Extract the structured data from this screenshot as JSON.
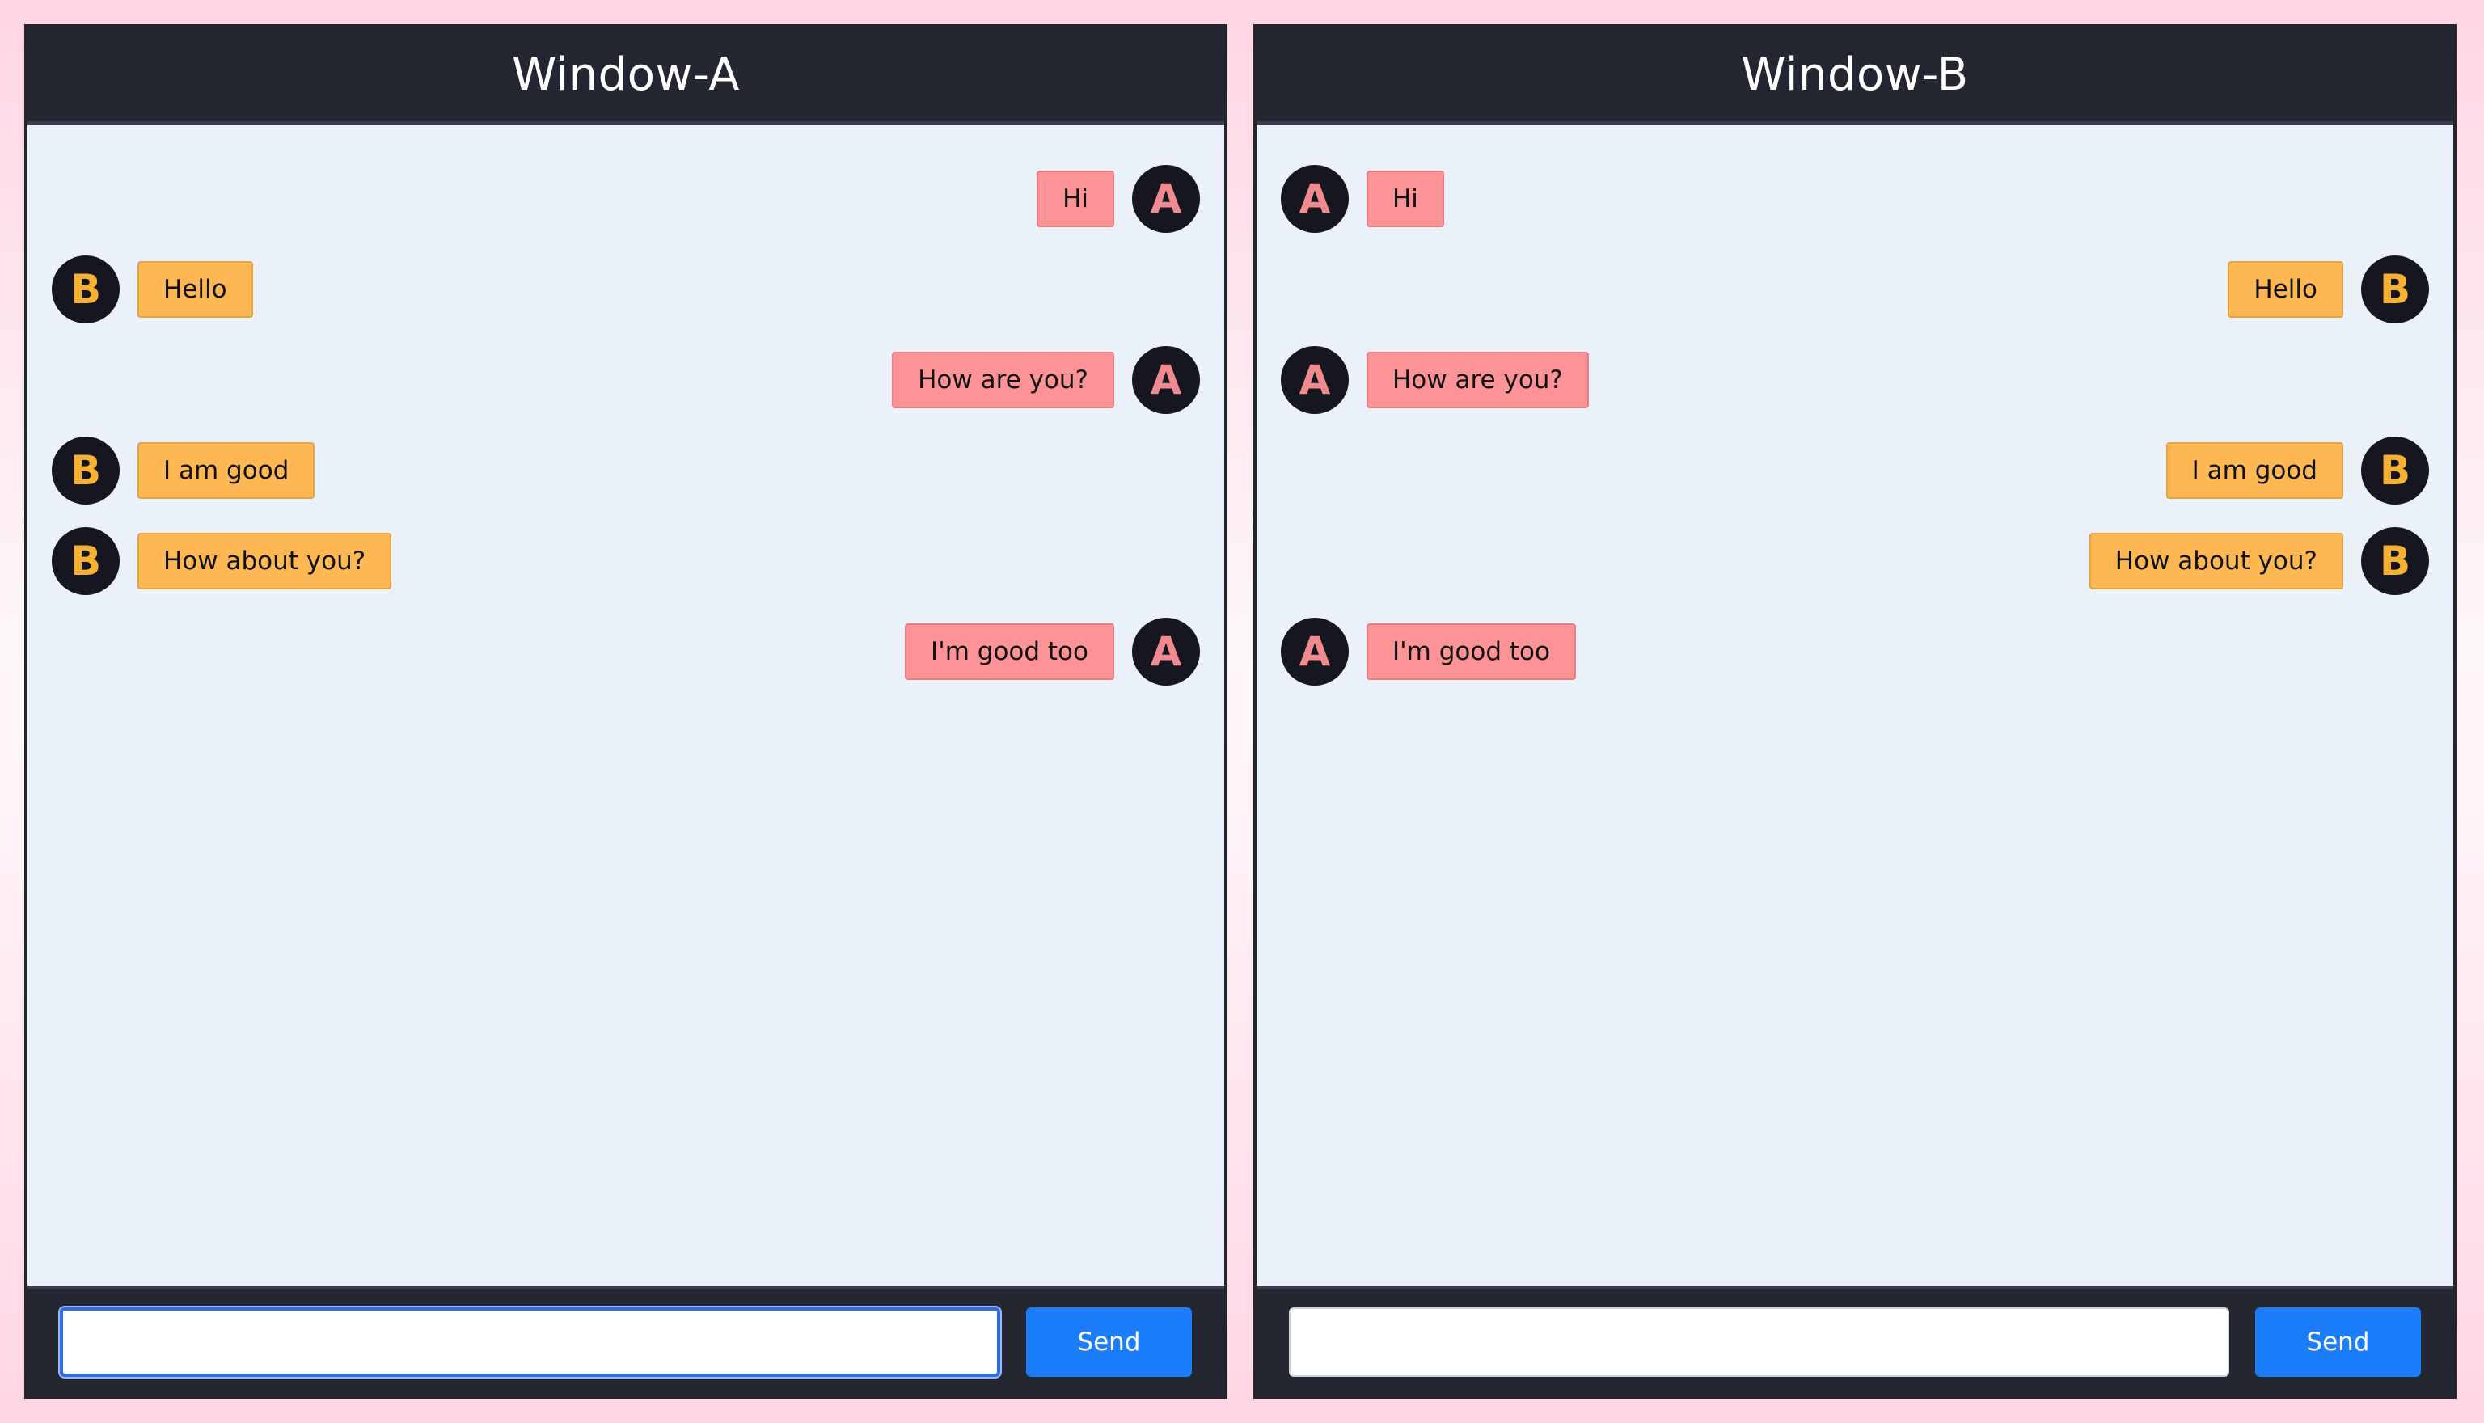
{
  "window_a": {
    "title": "Window-A",
    "send_label": "Send",
    "input_value": "",
    "input_focused": true,
    "messages": [
      {
        "sender": "A",
        "text": "Hi",
        "align": "right"
      },
      {
        "sender": "B",
        "text": "Hello",
        "align": "left"
      },
      {
        "sender": "A",
        "text": "How are you?",
        "align": "right"
      },
      {
        "sender": "B",
        "text": "I am good",
        "align": "left"
      },
      {
        "sender": "B",
        "text": "How about you?",
        "align": "left"
      },
      {
        "sender": "A",
        "text": "I'm good too",
        "align": "right"
      }
    ]
  },
  "window_b": {
    "title": "Window-B",
    "send_label": "Send",
    "input_value": "",
    "input_focused": false,
    "messages": [
      {
        "sender": "A",
        "text": "Hi",
        "align": "left"
      },
      {
        "sender": "B",
        "text": "Hello",
        "align": "right"
      },
      {
        "sender": "A",
        "text": "How are you?",
        "align": "left"
      },
      {
        "sender": "B",
        "text": "I am good",
        "align": "right"
      },
      {
        "sender": "B",
        "text": "How about you?",
        "align": "right"
      },
      {
        "sender": "A",
        "text": "I'm good too",
        "align": "left"
      }
    ]
  },
  "avatars": {
    "A": {
      "letter": "A",
      "icon": "avatar-a-icon",
      "color": "#f08a8e"
    },
    "B": {
      "letter": "B",
      "icon": "avatar-b-icon",
      "color": "#f7b133"
    }
  },
  "colors": {
    "header_bg": "#242632",
    "chat_bg": "#eaf1fa",
    "bubble_a": "#fc9396",
    "bubble_b": "#fdb853",
    "send_button": "#1c7dfb"
  }
}
